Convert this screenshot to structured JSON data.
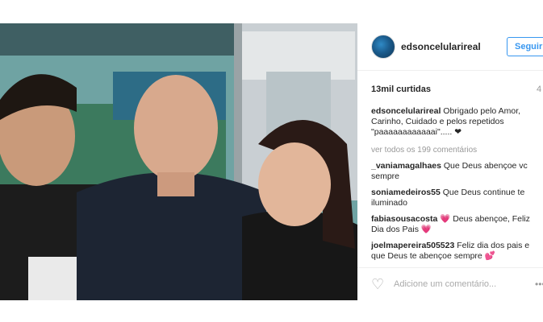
{
  "post": {
    "username": "edsoncelularireal",
    "follow_label": "Seguir",
    "likes": "13mil curtidas",
    "time": "4",
    "caption_user": "edsoncelularireal",
    "caption_text": "Obrigado pelo Amor, Carinho, Cuidado e pelos repetidos \"paaaaaaaaaaaai\"..... ❤",
    "view_all": "ver todos os 199 comentários",
    "comments": [
      {
        "user": "_vaniamagalhaes",
        "text": "Que Deus abençoe vc sempre"
      },
      {
        "user": "soniamedeiros55",
        "text": "Que Deus continue te iluminado"
      },
      {
        "user": "fabiasousacosta",
        "text": "💗 Deus abençoe, Feliz Dia dos Pais 💗"
      },
      {
        "user": "joelmapereira505523",
        "text": "Feliz dia dos pais e que Deus te abençoe sempre 💕"
      }
    ],
    "add_comment_placeholder": "Adicione um comentário...",
    "more_label": "•••",
    "icons": {
      "heart": "heart-icon",
      "avatar": "avatar"
    }
  }
}
